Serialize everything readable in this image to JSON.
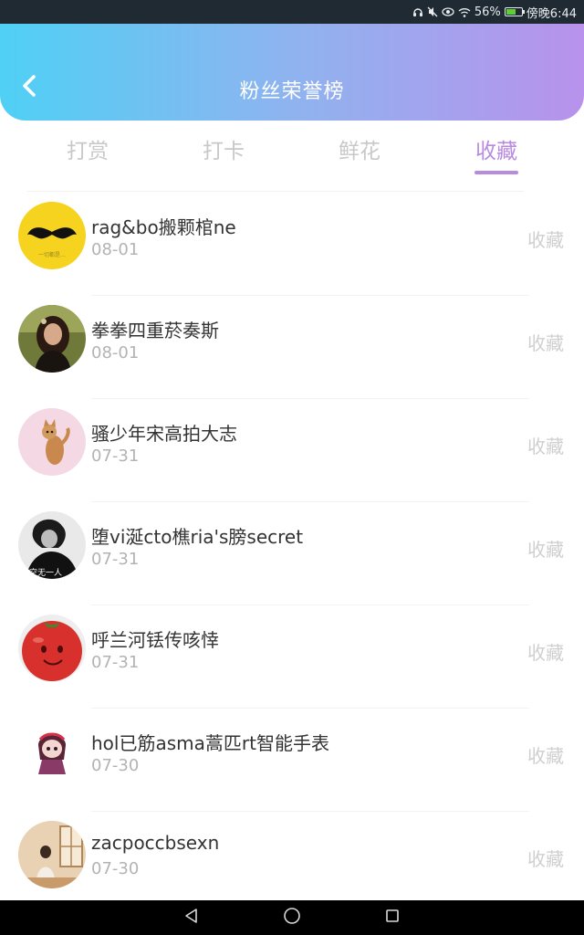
{
  "status_bar": {
    "battery_text": "56%",
    "battery_level": 0.56,
    "time": "傍晚6:44",
    "icons": [
      "headset-icon",
      "mute-icon",
      "eye-icon",
      "wifi-icon",
      "battery-icon"
    ]
  },
  "header": {
    "title": "粉丝荣誉榜",
    "back_icon": "chevron-left-icon"
  },
  "tabs": [
    {
      "label": "打赏",
      "active": false
    },
    {
      "label": "打卡",
      "active": false
    },
    {
      "label": "鲜花",
      "active": false
    },
    {
      "label": "收藏",
      "active": true
    }
  ],
  "colors": {
    "header_gradient_start": "#4fd0f5",
    "header_gradient_end": "#b892ec",
    "active_tab": "#b88ae0",
    "inactive_tab": "#c8c8c8"
  },
  "list": {
    "items": [
      {
        "name": "rag&bo搬颗棺ne",
        "date": "08-01",
        "action": "收藏",
        "avatar": "mustache-avatar"
      },
      {
        "name": "拳拳四重菸奏斯",
        "date": "08-01",
        "action": "收藏",
        "avatar": "woman-photo-avatar"
      },
      {
        "name": "骚少年宋高拍大志",
        "date": "07-31",
        "action": "收藏",
        "avatar": "cat-avatar"
      },
      {
        "name": "堕vi涎cto樵ria's膀secret",
        "date": "07-31",
        "action": "收藏",
        "avatar": "bw-photo-avatar"
      },
      {
        "name": "呼兰河铥传咳悻",
        "date": "07-31",
        "action": "收藏",
        "avatar": "tomato-avatar"
      },
      {
        "name": "hol已筋asma蒿匹rt智能手表",
        "date": "07-30",
        "action": "收藏",
        "avatar": "cartoon-girl-avatar"
      },
      {
        "name": "zacpoccbsexn",
        "date": "07-30",
        "action": "收藏",
        "avatar": "room-photo-avatar"
      }
    ]
  },
  "nav_bar": {
    "buttons": [
      "back-triangle-icon",
      "home-circle-icon",
      "recents-square-icon"
    ]
  }
}
